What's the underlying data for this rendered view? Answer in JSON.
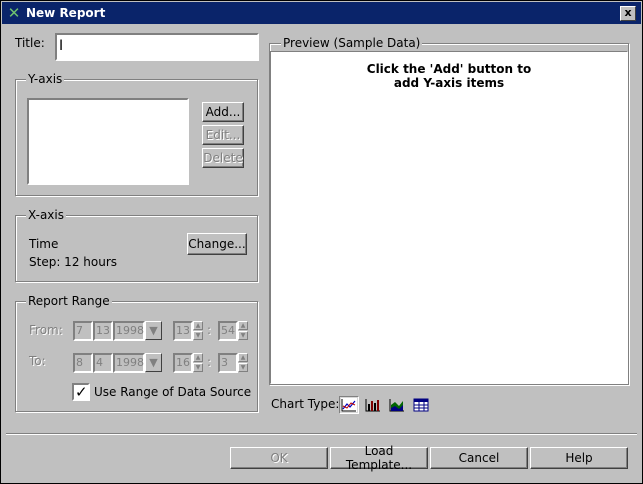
{
  "window": {
    "title": "New Report",
    "close_glyph": "x"
  },
  "title_field": {
    "label": "Title:",
    "value": ""
  },
  "y_axis": {
    "legend": "Y-axis",
    "items": [],
    "buttons": {
      "add": "Add...",
      "edit": "Edit...",
      "delete": "Delete"
    }
  },
  "x_axis": {
    "legend": "X-axis",
    "variable": "Time",
    "step": "Step: 12 hours",
    "change_button": "Change..."
  },
  "report_range": {
    "legend": "Report Range",
    "from": {
      "label": "From:",
      "month": "7",
      "day": "13",
      "year": "1998",
      "hour": "13",
      "minute": "54"
    },
    "to": {
      "label": "To:",
      "month": "8",
      "day": "4",
      "year": "1998",
      "hour": "16",
      "minute": "3"
    },
    "time_separator": ":",
    "use_data_source": {
      "label": "Use Range of Data Source",
      "checked": true,
      "check_glyph": "✓"
    }
  },
  "preview": {
    "legend": "Preview (Sample Data)",
    "message_line1": "Click the 'Add' button to",
    "message_line2": "add Y-axis items"
  },
  "chart_type": {
    "label": "Chart Type:",
    "options": [
      "line-chart-icon",
      "bar-chart-icon",
      "area-chart-icon",
      "table-icon"
    ],
    "selected": "line-chart-icon"
  },
  "footer": {
    "ok": "OK",
    "load_template": "Load Template...",
    "cancel": "Cancel",
    "help": "Help"
  }
}
